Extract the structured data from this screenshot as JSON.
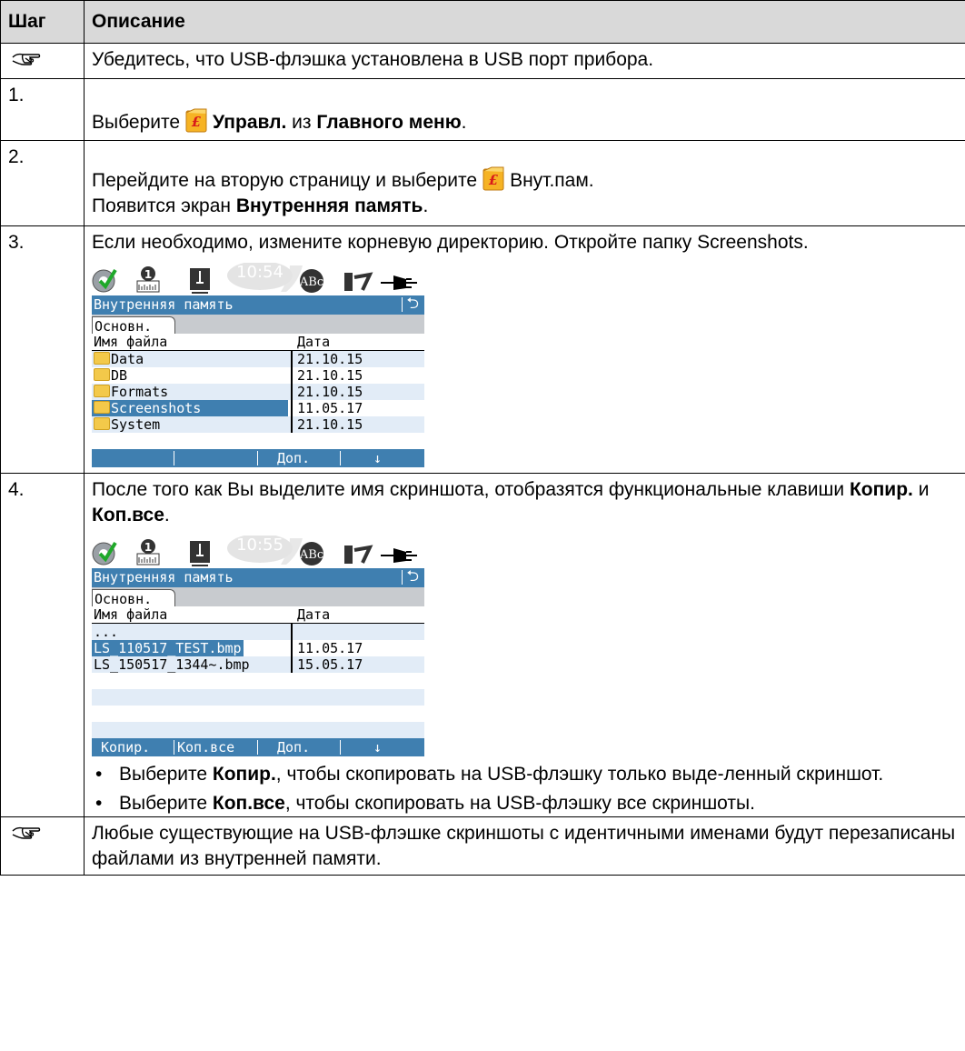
{
  "header": {
    "step": "Шаг",
    "desc": "Описание"
  },
  "note1": "Убедитесь, что USB-флэшка установлена в USB порт прибора.",
  "step1": {
    "num": "1.",
    "t1": "Выберите",
    "b1": "Управл.",
    "t2": "из",
    "b2": "Главного меню",
    "t3": "."
  },
  "step2": {
    "num": "2.",
    "t1": "Перейдите на вторую страницу и выберите",
    "t2": "Внут.пам.",
    "t3": "Появится экран",
    "b1": "Внутренняя память",
    "t4": "."
  },
  "step3": {
    "num": "3.",
    "text": "Если необходимо, измените корневую директорию. Откройте папку Screenshots."
  },
  "step4": {
    "num": "4.",
    "t1": "После того как Вы выделите имя скриншота, отобразятся функциональные клавиши",
    "b1": "Копир.",
    "t2": "и",
    "b2": "Коп.все",
    "t3": ".",
    "bullet1": {
      "t1": "Выберите",
      "b1": "Копир.",
      "t2": ", чтобы скопировать на USB-флэшку только выде-ленный скриншот."
    },
    "bullet2": {
      "t1": "Выберите",
      "b1": "Коп.все",
      "t2": ", чтобы скопировать на USB-флэшку все скриншоты."
    }
  },
  "note2": "Любые существующие на USB-флэшке скриншоты с идентичными именами будут перезаписаны файлами из внутренней памяти.",
  "screen1": {
    "time": "10:54",
    "title": "Внутренняя память",
    "tab": "Основн.",
    "col1": "Имя файла",
    "col2": "Дата",
    "rows": [
      {
        "name": "Data",
        "date": "21.10.15"
      },
      {
        "name": "DB",
        "date": "21.10.15"
      },
      {
        "name": "Formats",
        "date": "21.10.15"
      },
      {
        "name": "Screenshots",
        "date": "11.05.17"
      },
      {
        "name": "System",
        "date": "21.10.15"
      }
    ],
    "soft": [
      "",
      "",
      "Доп.",
      "↓"
    ]
  },
  "screen2": {
    "time": "10:55",
    "title": "Внутренняя память",
    "tab": "Основн.",
    "col1": "Имя файла",
    "col2": "Дата",
    "rows": [
      {
        "name": "...",
        "date": ""
      },
      {
        "name": "LS_110517_TEST.bmp",
        "date": "11.05.17"
      },
      {
        "name": "LS_150517_1344~.bmp",
        "date": "15.05.17"
      }
    ],
    "soft": [
      "Копир.",
      "Коп.все",
      "Доп.",
      "↓"
    ]
  },
  "colors": {
    "accent": "#3f7fb0",
    "header_bg": "#d9d9d9",
    "row_alt": "#e2ecf7"
  },
  "icons": [
    "pointing-hand-icon",
    "manage-folder-icon",
    "return-icon",
    "folder-icon"
  ]
}
